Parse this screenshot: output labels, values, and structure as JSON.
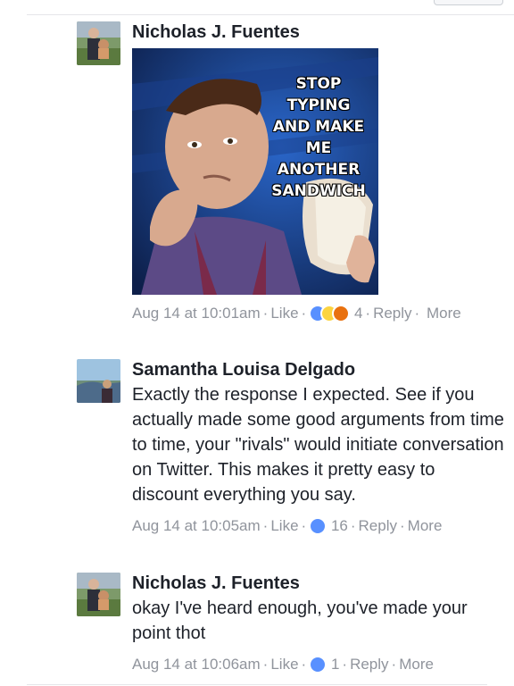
{
  "comments": [
    {
      "author": "Nicholas J. Fuentes",
      "meme_text": [
        "STOP TYPING",
        "AND MAKE",
        "ME ANOTHER",
        "SANDWICH"
      ],
      "time": "Aug 14 at 10:01am",
      "like": "Like",
      "reactions": [
        "like-icon",
        "haha-icon",
        "angry-icon"
      ],
      "count": "4",
      "reply": "Reply",
      "more": "More"
    },
    {
      "author": "Samantha Louisa Delgado",
      "text": "Exactly the response I expected. See if you actually made some good arguments from time to time, your \"rivals\" would initiate conversation on Twitter. This makes it pretty easy to discount everything you say.",
      "time": "Aug 14 at 10:05am",
      "like": "Like",
      "reactions": [
        "like-icon"
      ],
      "count": "16",
      "reply": "Reply",
      "more": "More"
    },
    {
      "author": "Nicholas J. Fuentes",
      "text": "okay I've heard enough, you've made your point thot",
      "time": "Aug 14 at 10:06am",
      "like": "Like",
      "reactions": [
        "like-icon"
      ],
      "count": "1",
      "reply": "Reply",
      "more": "More"
    }
  ],
  "colors": {
    "text": "#1d2129",
    "meta": "#90949c",
    "like_blue": "#5890ff",
    "haha_yellow": "#fcd440",
    "angry_orange": "#e9710f"
  }
}
